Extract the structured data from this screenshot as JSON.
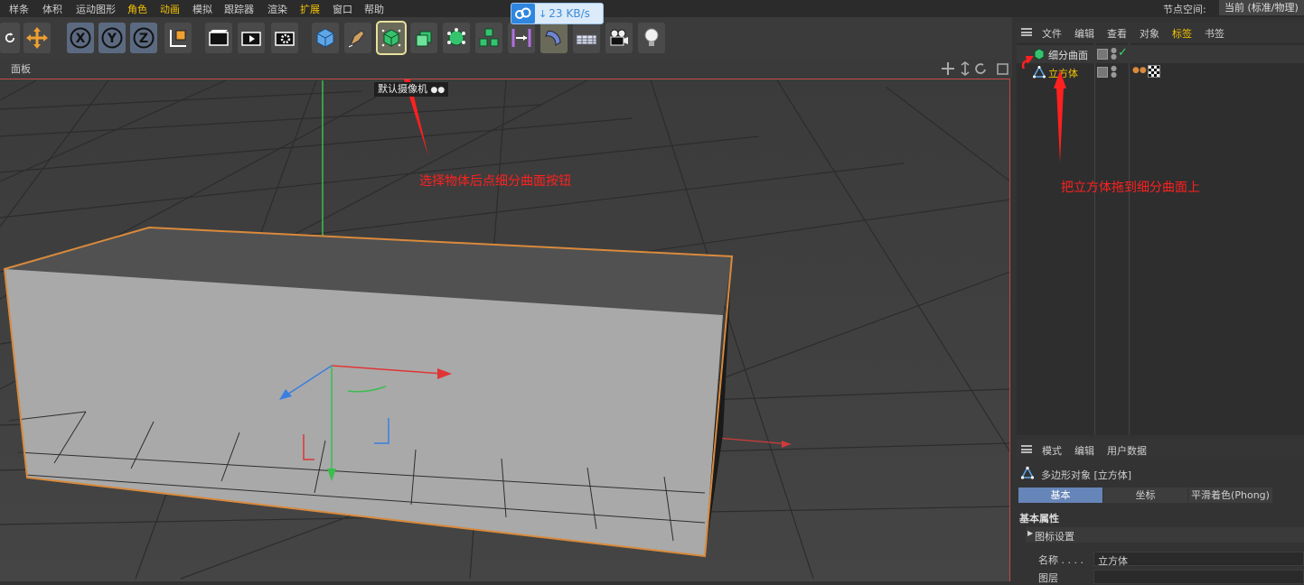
{
  "menubar": {
    "items": [
      "样条",
      "体积",
      "运动图形",
      "角色",
      "动画",
      "模拟",
      "跟踪器",
      "渲染",
      "扩展",
      "窗口",
      "帮助"
    ],
    "highlighted": [
      "角色",
      "动画",
      "扩展"
    ],
    "node_space_label": "节点空间:",
    "node_space_value": "当前 (标准/物理)"
  },
  "netspeed": {
    "value": "23",
    "unit": "KB/s"
  },
  "toolbar": {
    "x_label": "X",
    "y_label": "Y",
    "z_label": "Z",
    "icons": [
      "reset-icon",
      "move-icon",
      "x-axis-icon",
      "y-axis-icon",
      "z-axis-icon",
      "coordinate-system-icon",
      "render-view-icon",
      "render-picture-icon",
      "render-settings-icon",
      "cube-icon",
      "pen-icon",
      "subdivision-surface-icon",
      "extrude-icon",
      "cloner-icon",
      "array-icon",
      "symmetry-icon",
      "bend-icon",
      "floor-icon",
      "camera-icon",
      "light-icon"
    ]
  },
  "viewport": {
    "panel_label": "面板",
    "camera_label": "默认摄像机",
    "annotation_left": "选择物体后点细分曲面按钮",
    "annotation_right": "把立方体拖到细分曲面上"
  },
  "object_manager": {
    "menu": [
      "文件",
      "编辑",
      "查看",
      "对象",
      "标签",
      "书签"
    ],
    "highlighted": "标签",
    "objects": [
      {
        "name": "细分曲面",
        "icon": "subdivision-surface-icon",
        "color": "#e0e0e0"
      },
      {
        "name": "立方体",
        "icon": "polygon-object-icon",
        "color": "#f3c300"
      }
    ]
  },
  "attribute_manager": {
    "menu": [
      "模式",
      "编辑",
      "用户数据"
    ],
    "object_title": "多边形对象 [立方体]",
    "tabs": [
      "基本",
      "坐标",
      "平滑着色(Phong)"
    ],
    "active_tab": "基本",
    "section_title": "基本属性",
    "subsection": "图标设置",
    "name_label": "名称 . . . .",
    "name_value": "立方体",
    "layer_label": "图层"
  },
  "colors": {
    "accent": "#f3c300",
    "selection": "#d98a3c",
    "annotation": "#ff2020"
  }
}
